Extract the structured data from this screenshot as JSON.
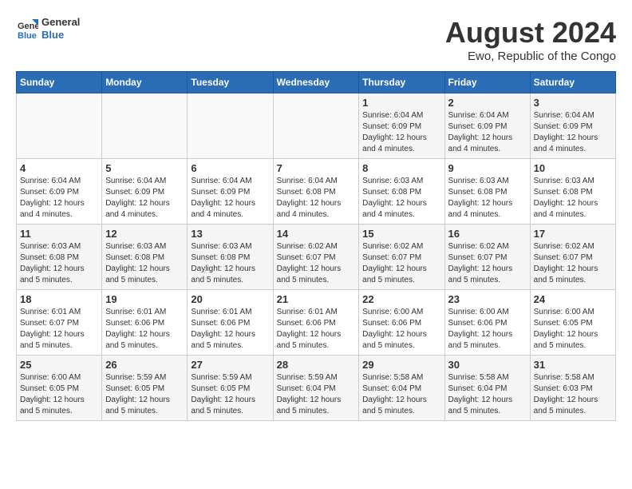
{
  "logo": {
    "line1": "General",
    "line2": "Blue"
  },
  "calendar": {
    "title": "August 2024",
    "subtitle": "Ewo, Republic of the Congo"
  },
  "headers": [
    "Sunday",
    "Monday",
    "Tuesday",
    "Wednesday",
    "Thursday",
    "Friday",
    "Saturday"
  ],
  "weeks": [
    [
      {
        "day": "",
        "info": ""
      },
      {
        "day": "",
        "info": ""
      },
      {
        "day": "",
        "info": ""
      },
      {
        "day": "",
        "info": ""
      },
      {
        "day": "1",
        "info": "Sunrise: 6:04 AM\nSunset: 6:09 PM\nDaylight: 12 hours\nand 4 minutes."
      },
      {
        "day": "2",
        "info": "Sunrise: 6:04 AM\nSunset: 6:09 PM\nDaylight: 12 hours\nand 4 minutes."
      },
      {
        "day": "3",
        "info": "Sunrise: 6:04 AM\nSunset: 6:09 PM\nDaylight: 12 hours\nand 4 minutes."
      }
    ],
    [
      {
        "day": "4",
        "info": "Sunrise: 6:04 AM\nSunset: 6:09 PM\nDaylight: 12 hours\nand 4 minutes."
      },
      {
        "day": "5",
        "info": "Sunrise: 6:04 AM\nSunset: 6:09 PM\nDaylight: 12 hours\nand 4 minutes."
      },
      {
        "day": "6",
        "info": "Sunrise: 6:04 AM\nSunset: 6:09 PM\nDaylight: 12 hours\nand 4 minutes."
      },
      {
        "day": "7",
        "info": "Sunrise: 6:04 AM\nSunset: 6:08 PM\nDaylight: 12 hours\nand 4 minutes."
      },
      {
        "day": "8",
        "info": "Sunrise: 6:03 AM\nSunset: 6:08 PM\nDaylight: 12 hours\nand 4 minutes."
      },
      {
        "day": "9",
        "info": "Sunrise: 6:03 AM\nSunset: 6:08 PM\nDaylight: 12 hours\nand 4 minutes."
      },
      {
        "day": "10",
        "info": "Sunrise: 6:03 AM\nSunset: 6:08 PM\nDaylight: 12 hours\nand 4 minutes."
      }
    ],
    [
      {
        "day": "11",
        "info": "Sunrise: 6:03 AM\nSunset: 6:08 PM\nDaylight: 12 hours\nand 5 minutes."
      },
      {
        "day": "12",
        "info": "Sunrise: 6:03 AM\nSunset: 6:08 PM\nDaylight: 12 hours\nand 5 minutes."
      },
      {
        "day": "13",
        "info": "Sunrise: 6:03 AM\nSunset: 6:08 PM\nDaylight: 12 hours\nand 5 minutes."
      },
      {
        "day": "14",
        "info": "Sunrise: 6:02 AM\nSunset: 6:07 PM\nDaylight: 12 hours\nand 5 minutes."
      },
      {
        "day": "15",
        "info": "Sunrise: 6:02 AM\nSunset: 6:07 PM\nDaylight: 12 hours\nand 5 minutes."
      },
      {
        "day": "16",
        "info": "Sunrise: 6:02 AM\nSunset: 6:07 PM\nDaylight: 12 hours\nand 5 minutes."
      },
      {
        "day": "17",
        "info": "Sunrise: 6:02 AM\nSunset: 6:07 PM\nDaylight: 12 hours\nand 5 minutes."
      }
    ],
    [
      {
        "day": "18",
        "info": "Sunrise: 6:01 AM\nSunset: 6:07 PM\nDaylight: 12 hours\nand 5 minutes."
      },
      {
        "day": "19",
        "info": "Sunrise: 6:01 AM\nSunset: 6:06 PM\nDaylight: 12 hours\nand 5 minutes."
      },
      {
        "day": "20",
        "info": "Sunrise: 6:01 AM\nSunset: 6:06 PM\nDaylight: 12 hours\nand 5 minutes."
      },
      {
        "day": "21",
        "info": "Sunrise: 6:01 AM\nSunset: 6:06 PM\nDaylight: 12 hours\nand 5 minutes."
      },
      {
        "day": "22",
        "info": "Sunrise: 6:00 AM\nSunset: 6:06 PM\nDaylight: 12 hours\nand 5 minutes."
      },
      {
        "day": "23",
        "info": "Sunrise: 6:00 AM\nSunset: 6:06 PM\nDaylight: 12 hours\nand 5 minutes."
      },
      {
        "day": "24",
        "info": "Sunrise: 6:00 AM\nSunset: 6:05 PM\nDaylight: 12 hours\nand 5 minutes."
      }
    ],
    [
      {
        "day": "25",
        "info": "Sunrise: 6:00 AM\nSunset: 6:05 PM\nDaylight: 12 hours\nand 5 minutes."
      },
      {
        "day": "26",
        "info": "Sunrise: 5:59 AM\nSunset: 6:05 PM\nDaylight: 12 hours\nand 5 minutes."
      },
      {
        "day": "27",
        "info": "Sunrise: 5:59 AM\nSunset: 6:05 PM\nDaylight: 12 hours\nand 5 minutes."
      },
      {
        "day": "28",
        "info": "Sunrise: 5:59 AM\nSunset: 6:04 PM\nDaylight: 12 hours\nand 5 minutes."
      },
      {
        "day": "29",
        "info": "Sunrise: 5:58 AM\nSunset: 6:04 PM\nDaylight: 12 hours\nand 5 minutes."
      },
      {
        "day": "30",
        "info": "Sunrise: 5:58 AM\nSunset: 6:04 PM\nDaylight: 12 hours\nand 5 minutes."
      },
      {
        "day": "31",
        "info": "Sunrise: 5:58 AM\nSunset: 6:03 PM\nDaylight: 12 hours\nand 5 minutes."
      }
    ]
  ]
}
